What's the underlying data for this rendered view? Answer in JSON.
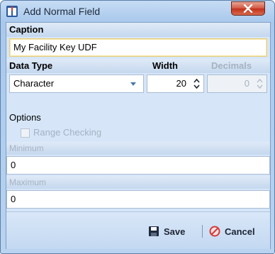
{
  "window": {
    "title": "Add Normal Field"
  },
  "caption": {
    "label": "Caption",
    "value": "My Facility Key UDF"
  },
  "data_type": {
    "label": "Data Type",
    "value": "Character"
  },
  "width": {
    "label": "Width",
    "value": "20"
  },
  "decimals": {
    "label": "Decimals",
    "value": "0"
  },
  "options": {
    "label": "Options",
    "range_checking_label": "Range Checking",
    "range_checking_checked": false
  },
  "minimum": {
    "label": "Minimum",
    "value": "0"
  },
  "maximum": {
    "label": "Maximum",
    "value": "0"
  },
  "footer": {
    "save_label": "Save",
    "cancel_label": "Cancel"
  },
  "icons": [
    "app-icon",
    "close-icon",
    "spin-up-icon",
    "spin-down-icon",
    "dropdown-arrow-icon",
    "save-icon",
    "cancel-icon"
  ],
  "colors": {
    "cancel_icon": "#d23a3a",
    "close_button": "#c9432c",
    "focus_border": "#e8cf7a"
  }
}
